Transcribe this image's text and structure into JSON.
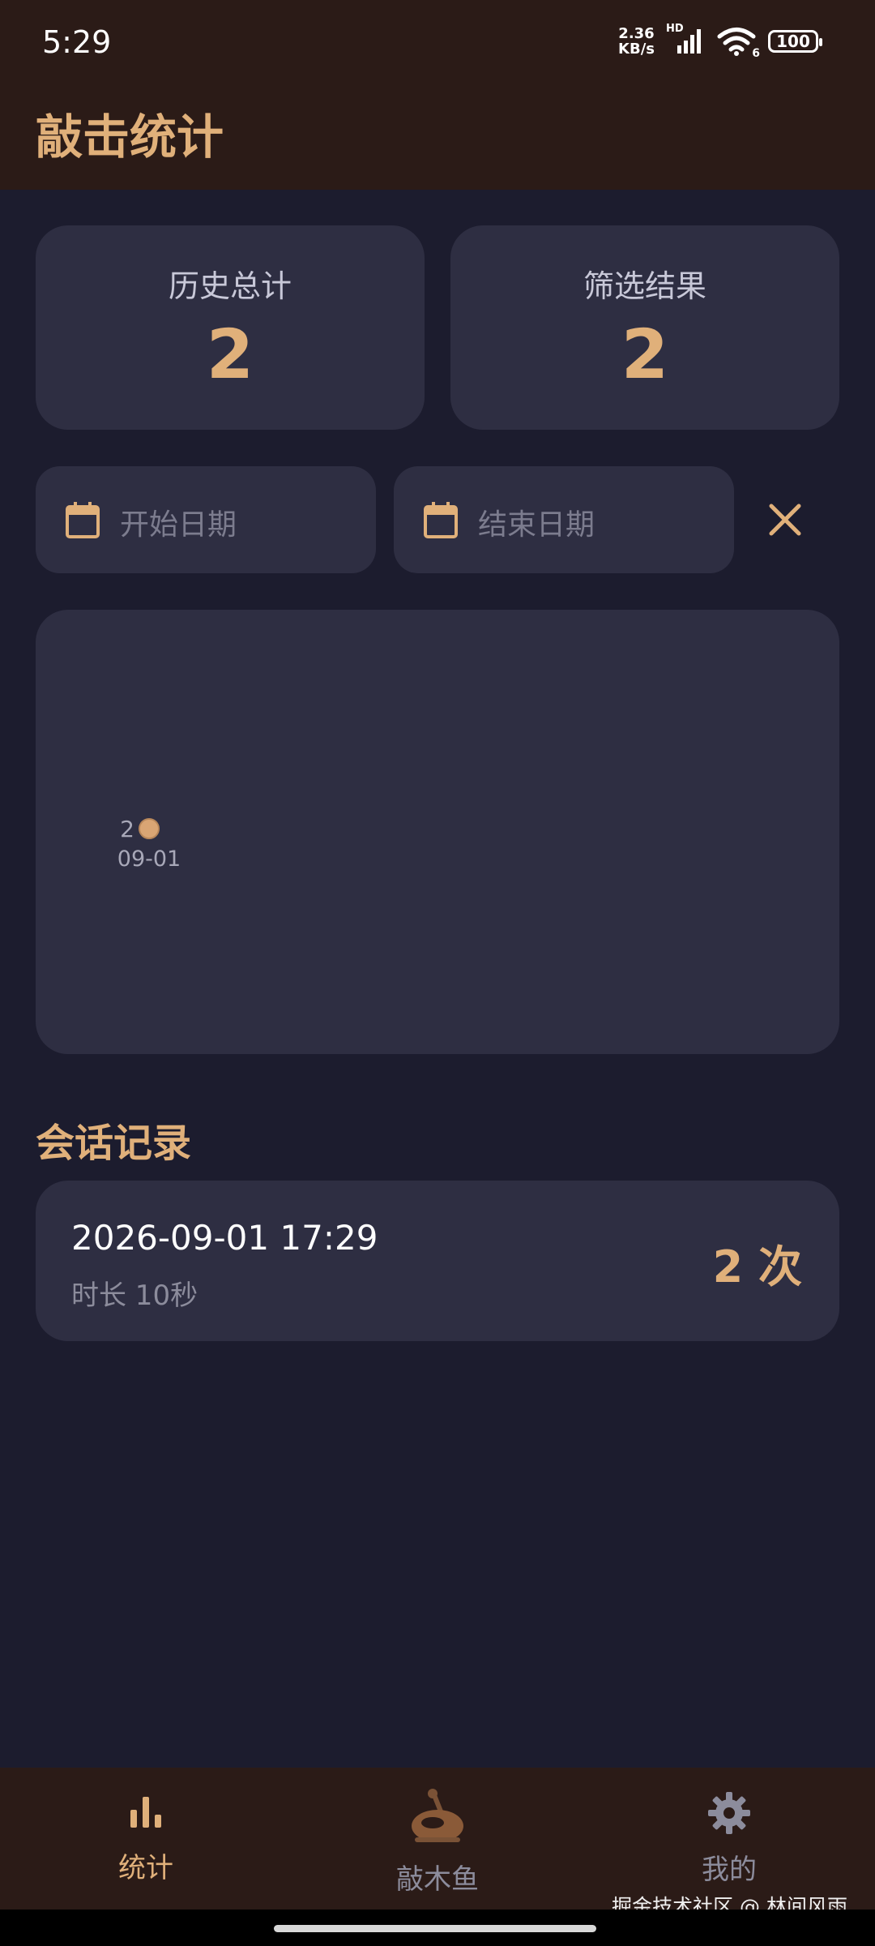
{
  "status_bar": {
    "time": "5:29",
    "net_speed_value": "2.36",
    "net_speed_unit": "KB/s",
    "hd_label": "HD",
    "wifi_badge": "6",
    "battery": "100"
  },
  "app_bar": {
    "title": "敲击统计"
  },
  "stats": {
    "total_label": "历史总计",
    "total_value": "2",
    "filtered_label": "筛选结果",
    "filtered_value": "2"
  },
  "filters": {
    "start_date_placeholder": "开始日期",
    "end_date_placeholder": "结束日期"
  },
  "chart_data": {
    "type": "line",
    "categories": [
      "09-01"
    ],
    "series": [
      {
        "values": [
          2
        ]
      }
    ],
    "data_labels": [
      "2"
    ],
    "color": "#d9a574"
  },
  "sessions": {
    "title": "会话记录",
    "items": [
      {
        "datetime": "2026-09-01 17:29",
        "duration": "时长 10秒",
        "count": "2 次"
      }
    ]
  },
  "bottom_nav": {
    "items": [
      {
        "label": "统计",
        "icon": "bar-chart-icon",
        "active": true
      },
      {
        "label": "敲木鱼",
        "icon": "wooden-fish-icon",
        "active": false
      },
      {
        "label": "我的",
        "icon": "gear-icon",
        "active": false
      }
    ]
  },
  "watermark": "掘金技术社区 @ 林间风雨",
  "colors": {
    "accent": "#e0b07a",
    "background": "#1c1c2e",
    "card": "#2e2e42",
    "bar": "#2b1b17"
  }
}
